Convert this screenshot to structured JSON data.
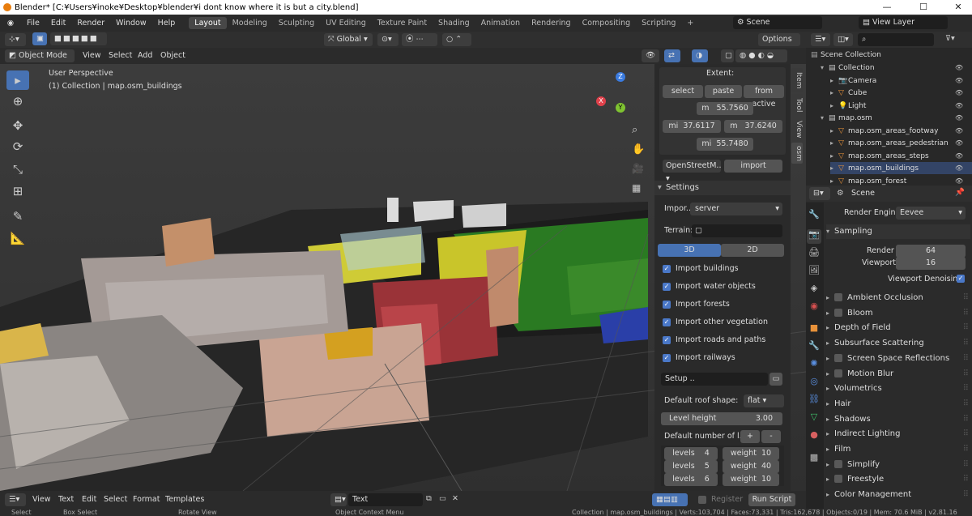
{
  "window": {
    "title": "Blender* [C:¥Users¥inoke¥Desktop¥blender¥i dont know where it is but a city.blend]"
  },
  "menus": [
    "File",
    "Edit",
    "Render",
    "Window",
    "Help"
  ],
  "workspaces": [
    "Layout",
    "Modeling",
    "Sculpting",
    "UV Editing",
    "Texture Paint",
    "Shading",
    "Animation",
    "Rendering",
    "Compositing",
    "Scripting"
  ],
  "active_workspace": "Layout",
  "scene": {
    "label": "Scene",
    "view_layer": "View Layer"
  },
  "header": {
    "transform": "Global",
    "options": "Options",
    "mode": "Object Mode",
    "view_menus": [
      "View",
      "Select",
      "Add",
      "Object"
    ]
  },
  "viewport": {
    "perspective": "User Perspective",
    "collection": "(1) Collection | map.osm_buildings",
    "axes": {
      "x": "X",
      "y": "Y",
      "z": "Z"
    }
  },
  "osm": {
    "extent_label": "Extent:",
    "buttons": [
      "select",
      "paste",
      "from active"
    ],
    "max_lat": "55.7560",
    "min_lon": "37.6117",
    "max_lon": "37.6240",
    "min_lat": "55.7480",
    "unit_m": "m",
    "unit_mi": "mi",
    "source": "OpenStreetM..",
    "import": "import",
    "settings": "Settings",
    "import_label": "Impor..",
    "import_value": "server",
    "terrain": "Terrain:",
    "mode3d": "3D",
    "mode2d": "2D",
    "checks": [
      "Import buildings",
      "Import water objects",
      "Import forests",
      "Import other vegetation",
      "Import roads and paths",
      "Import railways"
    ],
    "setup": "Setup ..",
    "roof_label": "Default roof shape:",
    "roof_value": "flat",
    "level_height_label": "Level height",
    "level_height_value": "3.00",
    "default_num": "Default number of l..",
    "plus": "+",
    "minus": "-",
    "levels": [
      {
        "l": "levels",
        "lv": "4",
        "w": "weight",
        "wv": "10"
      },
      {
        "l": "levels",
        "lv": "5",
        "w": "weight",
        "wv": "40"
      },
      {
        "l": "levels",
        "lv": "6",
        "w": "weight",
        "wv": "10"
      }
    ]
  },
  "sidetabs": [
    "Item",
    "Tool",
    "View",
    "osm"
  ],
  "outliner": {
    "title": "Scene Collection",
    "items": [
      {
        "name": "Collection",
        "indent": 1
      },
      {
        "name": "Camera",
        "indent": 2
      },
      {
        "name": "Cube",
        "indent": 2
      },
      {
        "name": "Light",
        "indent": 2
      },
      {
        "name": "map.osm",
        "indent": 1
      },
      {
        "name": "map.osm_areas_footway",
        "indent": 2
      },
      {
        "name": "map.osm_areas_pedestrian",
        "indent": 2
      },
      {
        "name": "map.osm_areas_steps",
        "indent": 2
      },
      {
        "name": "map.osm_buildings",
        "indent": 2
      },
      {
        "name": "map.osm_forest",
        "indent": 2
      }
    ]
  },
  "properties": {
    "scene": "Scene",
    "render_engine_label": "Render Engine",
    "render_engine": "Eevee",
    "sampling": "Sampling",
    "render_label": "Render",
    "render_value": "64",
    "viewport_label": "Viewport",
    "viewport_value": "16",
    "denoise": "Viewport Denoising",
    "panels": [
      {
        "name": "Ambient Occlusion",
        "check": true
      },
      {
        "name": "Bloom",
        "check": true
      },
      {
        "name": "Depth of Field",
        "check": false
      },
      {
        "name": "Subsurface Scattering",
        "check": false
      },
      {
        "name": "Screen Space Reflections",
        "check": true
      },
      {
        "name": "Motion Blur",
        "check": true
      },
      {
        "name": "Volumetrics",
        "check": false
      },
      {
        "name": "Hair",
        "check": false
      },
      {
        "name": "Shadows",
        "check": false
      },
      {
        "name": "Indirect Lighting",
        "check": false
      },
      {
        "name": "Film",
        "check": false
      },
      {
        "name": "Simplify",
        "check": true
      },
      {
        "name": "Freestyle",
        "check": true
      },
      {
        "name": "Color Management",
        "check": false
      }
    ]
  },
  "texteditor": {
    "menus": [
      "View",
      "Text",
      "Edit",
      "Select",
      "Format",
      "Templates"
    ],
    "name": "Text",
    "register": "Register",
    "run": "Run Script"
  },
  "status": {
    "select": "Select",
    "box": "Box Select",
    "rotate": "Rotate View",
    "context": "Object Context Menu",
    "info": "Collection | map.osm_buildings | Verts:103,704 | Faces:73,331 | Tris:162,678 | Objects:0/19 | Mem: 70.6 MiB | v2.81.16"
  }
}
